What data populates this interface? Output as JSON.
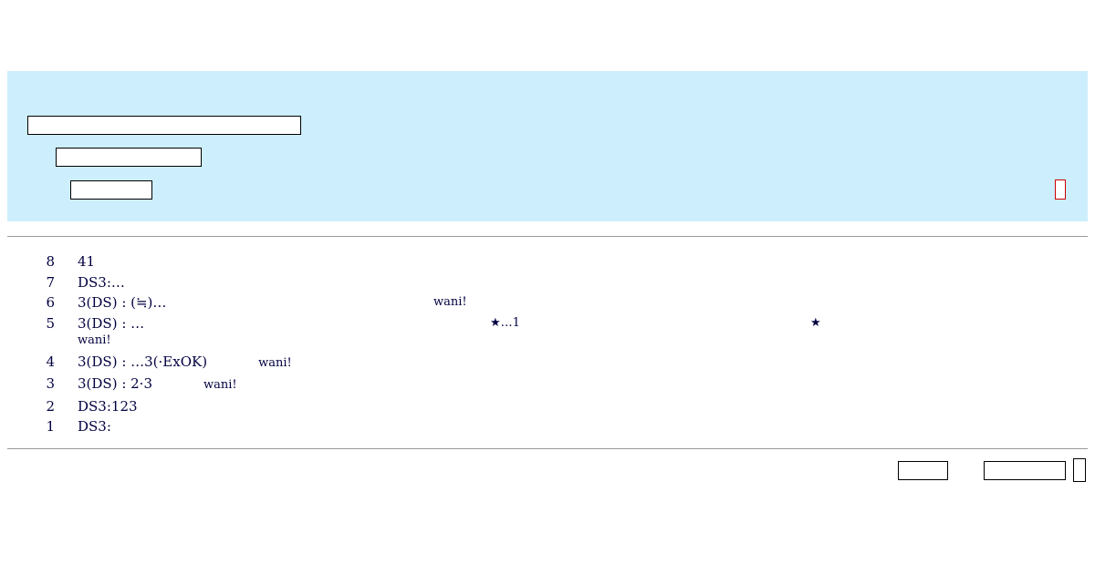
{
  "form": {
    "name_value": "",
    "email_value": "",
    "password_value": ""
  },
  "comments": [
    {
      "num": "8",
      "text": "41"
    },
    {
      "num": "7",
      "text": "DS3:…"
    },
    {
      "num": "6",
      "text": "3(DS) : (≒)…",
      "badge": "wani!"
    },
    {
      "num": "5",
      "text": "3(DS) : …",
      "mid": "★…1",
      "star": "★",
      "badge": "wani!"
    },
    {
      "num": "4",
      "text": "3(DS) : …3(·ExOK)",
      "badge": "wani!"
    },
    {
      "num": "3",
      "text": "3(DS) : 2·3",
      "badge": "wani!"
    },
    {
      "num": "2",
      "text": "DS3:123"
    },
    {
      "num": "1",
      "text": "DS3:"
    }
  ],
  "footer": {
    "button_a_label": "",
    "button_b_label": "",
    "button_c_label": ""
  }
}
